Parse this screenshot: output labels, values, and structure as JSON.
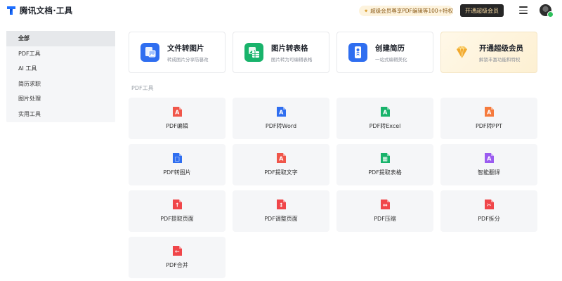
{
  "header": {
    "app_title": "腾讯文档·工具",
    "promo_text": "超级会员尊享PDF编辑等100+特权",
    "open_button": "开通超级会员"
  },
  "sidebar": {
    "items": [
      {
        "label": "全部",
        "active": true
      },
      {
        "label": "PDF工具"
      },
      {
        "label": "AI 工具"
      },
      {
        "label": "简历求职"
      },
      {
        "label": "图片处理"
      },
      {
        "label": "实用工具"
      }
    ]
  },
  "features": [
    {
      "title": "文件转图片",
      "subtitle": "转成图片分享防篡改",
      "icon": "file-to-image-icon",
      "color": "#2f6ef0"
    },
    {
      "title": "图片转表格",
      "subtitle": "图片转为可编辑表格",
      "icon": "image-to-sheet-icon",
      "color": "#18b36b"
    },
    {
      "title": "创建简历",
      "subtitle": "一站式编辑美化",
      "icon": "resume-icon",
      "color": "#2f6ef0"
    },
    {
      "title": "开通超级会员",
      "subtitle": "解锁丰富功能和特权",
      "icon": "diamond-icon",
      "color": "#f2b43c"
    }
  ],
  "section_title": "PDF工具",
  "tools": [
    {
      "label": "PDF编辑",
      "icon": "pdf-edit-icon",
      "color": "#f0564a"
    },
    {
      "label": "PDF转Word",
      "icon": "pdf-to-word-icon",
      "color": "#2f6ef0"
    },
    {
      "label": "PDF转Excel",
      "icon": "pdf-to-excel-icon",
      "color": "#18b36b"
    },
    {
      "label": "PDF转PPT",
      "icon": "pdf-to-ppt-icon",
      "color": "#f57a3d"
    },
    {
      "label": "PDF转图片",
      "icon": "pdf-to-image-icon",
      "color": "#2f6ef0"
    },
    {
      "label": "PDF提取文字",
      "icon": "pdf-extract-text-icon",
      "color": "#f0564a"
    },
    {
      "label": "PDF提取表格",
      "icon": "pdf-extract-table-icon",
      "color": "#18b36b"
    },
    {
      "label": "智能翻译",
      "icon": "translate-icon",
      "color": "#9b5cf0"
    },
    {
      "label": "PDF提取页面",
      "icon": "pdf-extract-page-icon",
      "color": "#f0464a"
    },
    {
      "label": "PDF调整页面",
      "icon": "pdf-adjust-page-icon",
      "color": "#f0464a"
    },
    {
      "label": "PDF压缩",
      "icon": "pdf-compress-icon",
      "color": "#f0464a"
    },
    {
      "label": "PDF拆分",
      "icon": "pdf-split-icon",
      "color": "#f0464a"
    },
    {
      "label": "PDF合并",
      "icon": "pdf-merge-icon",
      "color": "#f0464a"
    }
  ]
}
